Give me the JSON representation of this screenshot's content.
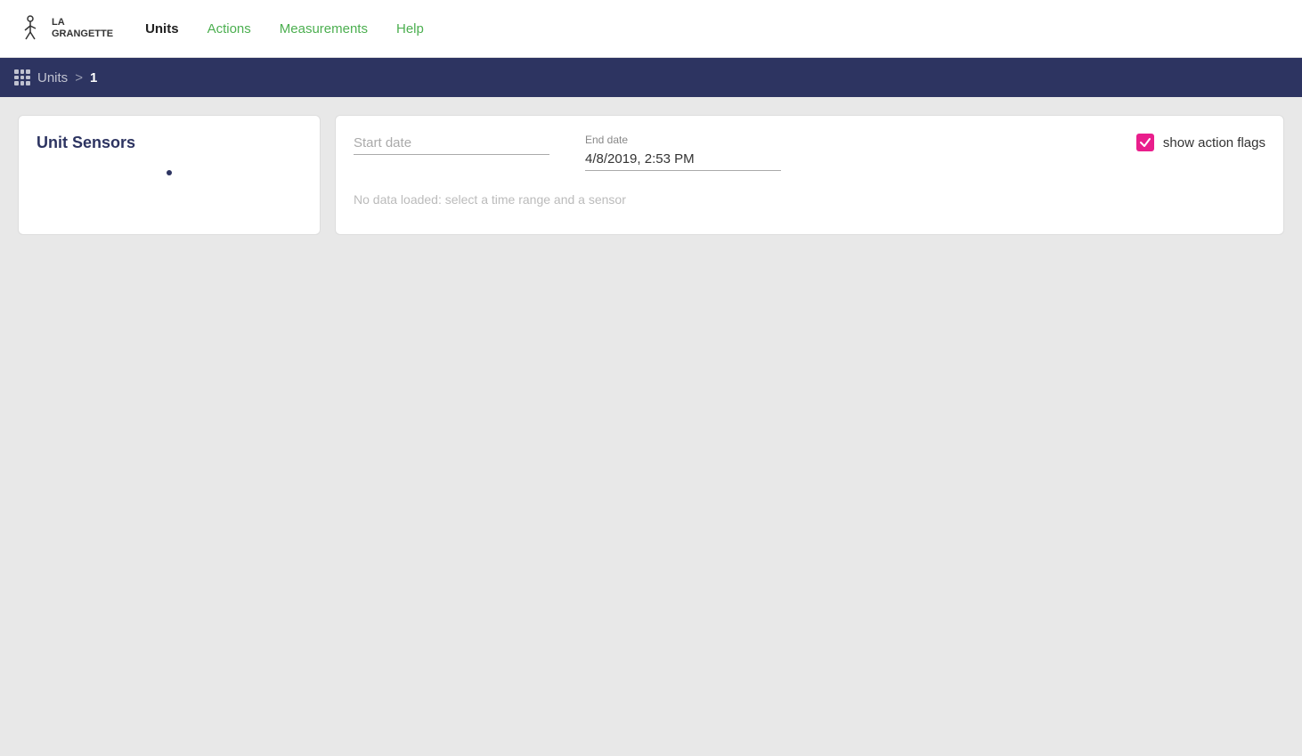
{
  "nav": {
    "logo_line1": "LA",
    "logo_line2": "GRANGETTE",
    "links": [
      {
        "label": "Units",
        "active": true,
        "green": false
      },
      {
        "label": "Actions",
        "active": false,
        "green": true
      },
      {
        "label": "Measurements",
        "active": false,
        "green": true
      },
      {
        "label": "Help",
        "active": false,
        "green": true
      }
    ]
  },
  "breadcrumb": {
    "units_label": "Units",
    "separator": ">",
    "current": "1"
  },
  "unit_sensors": {
    "title": "Unit Sensors"
  },
  "data_panel": {
    "start_date_label": "Start date",
    "start_date_value": "",
    "start_date_placeholder": "Start date",
    "end_date_label": "End date",
    "end_date_value": "4/8/2019, 2:53 PM",
    "show_action_flags_label": "show action flags",
    "no_data_message": "No data loaded: select a time range and a sensor"
  }
}
